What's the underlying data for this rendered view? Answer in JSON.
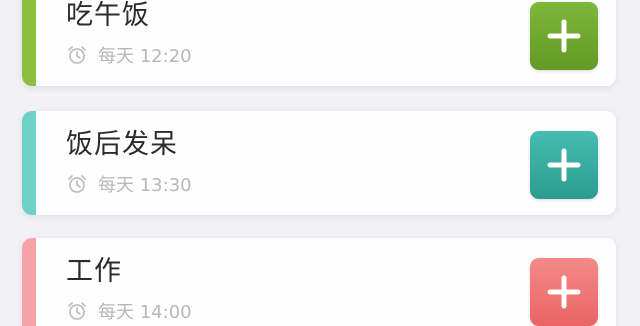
{
  "tasks": [
    {
      "title": "吃午饭",
      "icon": "alarm-clock-icon",
      "time_text": "每天 12:20",
      "accent": "#8cbf3f",
      "button_color": "#6ea329",
      "button_icon": "plus-icon"
    },
    {
      "title": "饭后发呆",
      "icon": "alarm-clock-icon",
      "time_text": "每天 13:30",
      "accent": "#6fd0c8",
      "button_color": "#34a89c",
      "button_icon": "plus-icon"
    },
    {
      "title": "工作",
      "icon": "alarm-clock-icon",
      "time_text": "每天 14:00",
      "accent": "#f5a3a6",
      "button_color": "#ee7272",
      "button_icon": "plus-icon"
    }
  ]
}
